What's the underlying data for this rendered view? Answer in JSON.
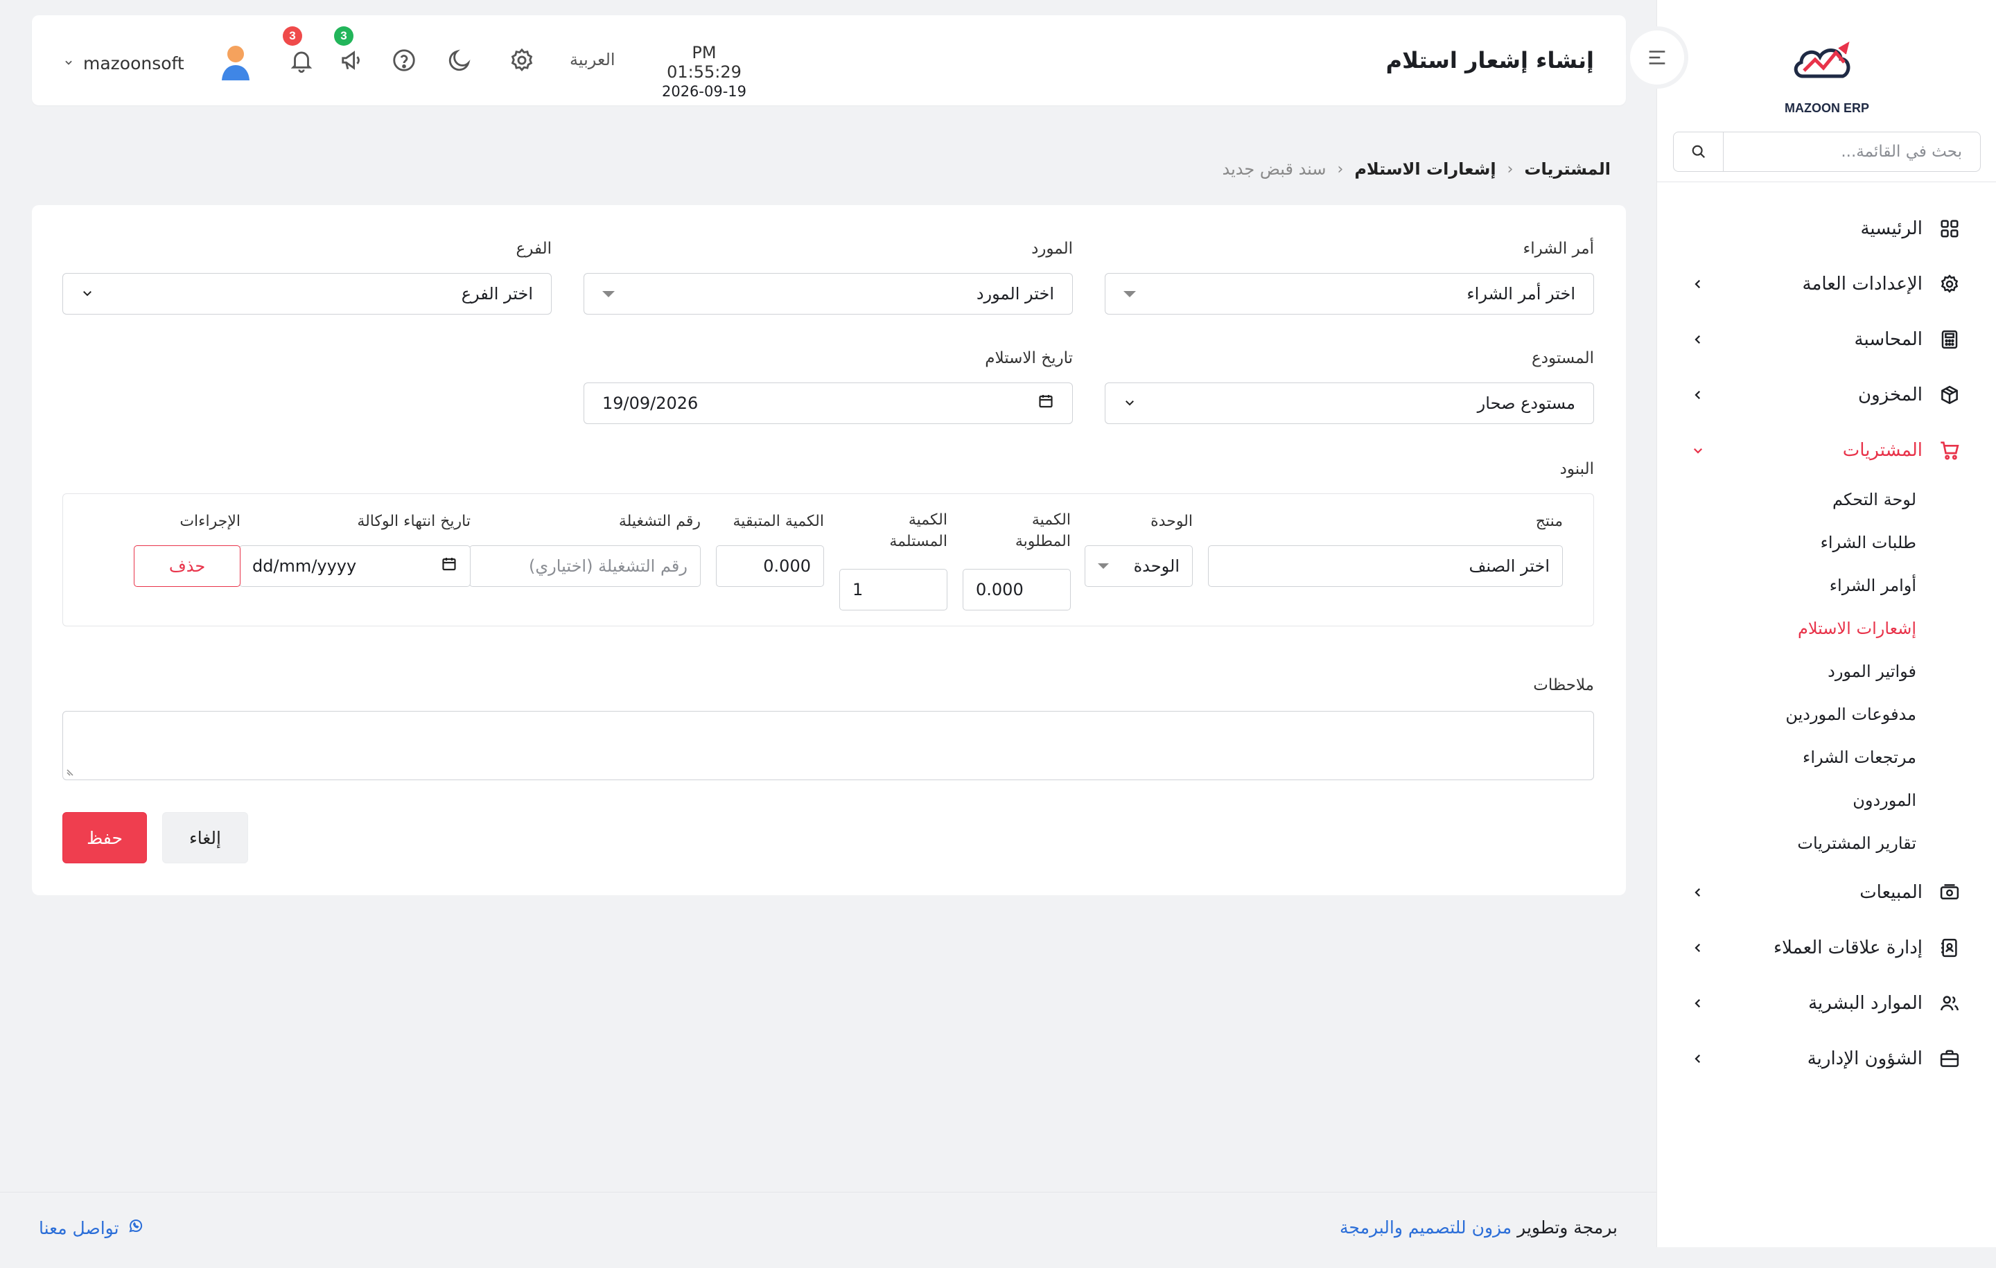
{
  "app": {
    "brand": "MAZOON ERP"
  },
  "header": {
    "title": "إنشاء إشعار استلام",
    "time": "PM 01:55:29",
    "date": "2026-09-19",
    "language": "العربية",
    "notifications_count": "3",
    "announcements_count": "3",
    "username": "mazoonsoft"
  },
  "sidebar": {
    "search_placeholder": "بحث في القائمة...",
    "items": [
      {
        "label": "الرئيسية",
        "icon": "grid-icon"
      },
      {
        "label": "الإعدادات العامة",
        "icon": "gear-icon"
      },
      {
        "label": "المحاسبة",
        "icon": "calculator-icon"
      },
      {
        "label": "المخزون",
        "icon": "box-icon"
      },
      {
        "label": "المشتريات",
        "icon": "cart-icon"
      },
      {
        "label": "المبيعات",
        "icon": "cash-icon"
      },
      {
        "label": "إدارة علاقات العملاء",
        "icon": "contacts-icon"
      },
      {
        "label": "الموارد البشرية",
        "icon": "users-icon"
      },
      {
        "label": "الشؤون الإدارية",
        "icon": "briefcase-icon"
      }
    ],
    "purchases_sub": [
      "لوحة التحكم",
      "طلبات الشراء",
      "أوامر الشراء",
      "إشعارات الاستلام",
      "فواتير المورد",
      "مدفوعات الموردين",
      "مرتجعات الشراء",
      "الموردون",
      "تقارير المشتريات"
    ]
  },
  "breadcrumb": {
    "level1": "المشتريات",
    "level2": "إشعارات الاستلام",
    "level3": "سند قبض جديد"
  },
  "form": {
    "purchase_order_label": "أمر الشراء",
    "purchase_order_value": "اختر أمر الشراء",
    "supplier_label": "المورد",
    "supplier_value": "اختر المورد",
    "branch_label": "الفرع",
    "branch_value": "اختر الفرع",
    "warehouse_label": "المستودع",
    "warehouse_value": "مستودع صحار",
    "receipt_date_label": "تاريخ الاستلام",
    "receipt_date_value": "19/09/2026",
    "items_label": "البنود",
    "notes_label": "ملاحظات"
  },
  "items_table": {
    "headers": {
      "product": "منتج",
      "unit": "الوحدة",
      "required_qty": "الكمية المطلوبة",
      "received_qty": "الكمية المستلمة",
      "remaining_qty": "الكمية المتبقية",
      "batch_no": "رقم التشغيلة",
      "agency_expiry": "تاريخ انتهاء الوكالة",
      "actions": "الإجراءات"
    },
    "row": {
      "product": "اختر الصنف",
      "unit": "الوحدة",
      "required_qty": "0.000",
      "received_qty": "1",
      "remaining_qty": "0.000",
      "batch_placeholder": "رقم التشغيلة (اختياري)",
      "expiry_placeholder": "dd/mm/yyyy",
      "delete_label": "حذف"
    }
  },
  "actions": {
    "save_label": "حفظ",
    "cancel_label": "إلغاء"
  },
  "footer": {
    "credit_prefix": "برمجة وتطوير",
    "credit_link": "مزون للتصميم والبرمجة",
    "contact": "تواصل معنا"
  },
  "colors": {
    "accent": "#e8334a",
    "link": "#2b6ed8",
    "badge_red": "#ef4a4a",
    "badge_green": "#22b55a"
  }
}
